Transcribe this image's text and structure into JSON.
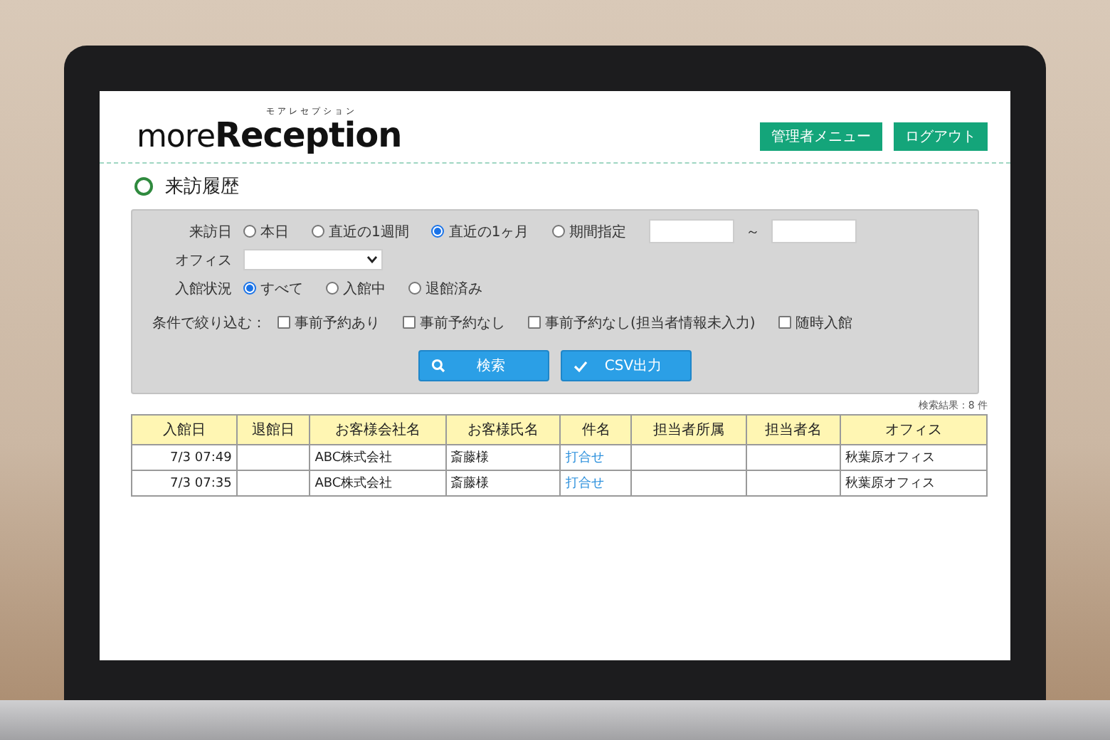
{
  "header": {
    "logo": "more**Reception**",
    "logo_ruby": "モアレセプション",
    "buttons": [
      "管理者メニュー",
      "ログアウト"
    ]
  },
  "page_title": "来訪履歴",
  "filters": {
    "visit_date": {
      "label": "来訪日",
      "options": [
        {
          "label": "本日",
          "selected": false
        },
        {
          "label": "直近の1週間",
          "selected": false
        },
        {
          "label": "直近の1ヶ月",
          "selected": true
        },
        {
          "label": "期間指定",
          "selected": false
        }
      ],
      "range_separator": "～"
    },
    "office": {
      "label": "オフィス"
    },
    "status": {
      "label": "入館状況",
      "options": [
        {
          "label": "すべて",
          "selected": true
        },
        {
          "label": "入館中",
          "selected": false
        },
        {
          "label": "退館済み",
          "selected": false
        }
      ]
    },
    "narrow": {
      "label": "条件で絞り込む：",
      "options": [
        {
          "label": "事前予約あり",
          "checked": false
        },
        {
          "label": "事前予約なし",
          "checked": false
        },
        {
          "label": "事前予約なし(担当者情報未入力)",
          "checked": false
        },
        {
          "label": "随時入館",
          "checked": false
        }
      ]
    }
  },
  "actions": [
    {
      "kind": "search",
      "label": "検索"
    },
    {
      "kind": "csv",
      "label": "CSV出力"
    }
  ],
  "result_count": "検索結果：8 件",
  "table": {
    "columns": [
      {
        "label": "入館日",
        "kind": "time"
      },
      {
        "label": "退館日",
        "kind": "time"
      },
      {
        "label": "お客様会社名",
        "kind": "text"
      },
      {
        "label": "お客様氏名",
        "kind": "text"
      },
      {
        "label": "件名",
        "kind": "link"
      },
      {
        "label": "担当者所属",
        "kind": "text"
      },
      {
        "label": "担当者名",
        "kind": "text"
      },
      {
        "label": "オフィス",
        "kind": "text"
      }
    ],
    "rows": [
      [
        "7/3 07:49",
        null,
        "ABC株式会社",
        "斎藤様",
        "打合せ",
        null,
        null,
        "秋葉原オフィス"
      ],
      [
        "7/3 07:35",
        null,
        "ABC株式会社",
        "斎藤様",
        "打合せ",
        null,
        null,
        "秋葉原オフィス"
      ]
    ]
  }
}
